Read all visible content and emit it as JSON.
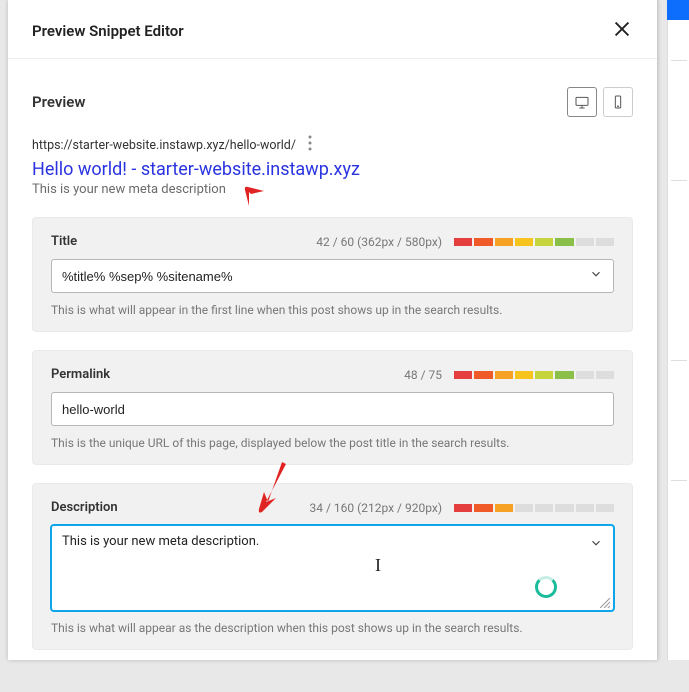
{
  "header": {
    "title": "Preview Snippet Editor"
  },
  "preview": {
    "label": "Preview",
    "url": "https://starter-website.instawp.xyz/hello-world/",
    "title": "Hello world! - starter-website.instawp.xyz",
    "description": "This is your new meta description"
  },
  "panels": {
    "title": {
      "label": "Title",
      "counter": "42 / 60 (362px / 580px)",
      "value": "%title% %sep% %sitename%",
      "hint": "This is what will appear in the first line when this post shows up in the search results."
    },
    "permalink": {
      "label": "Permalink",
      "counter": "48 / 75",
      "value": "hello-world",
      "hint": "This is the unique URL of this page, displayed below the post title in the search results."
    },
    "description": {
      "label": "Description",
      "counter": "34 / 160 (212px / 920px)",
      "value": "This is your new meta description.",
      "hint": "This is what will appear as the description when this post shows up in the search results."
    }
  }
}
